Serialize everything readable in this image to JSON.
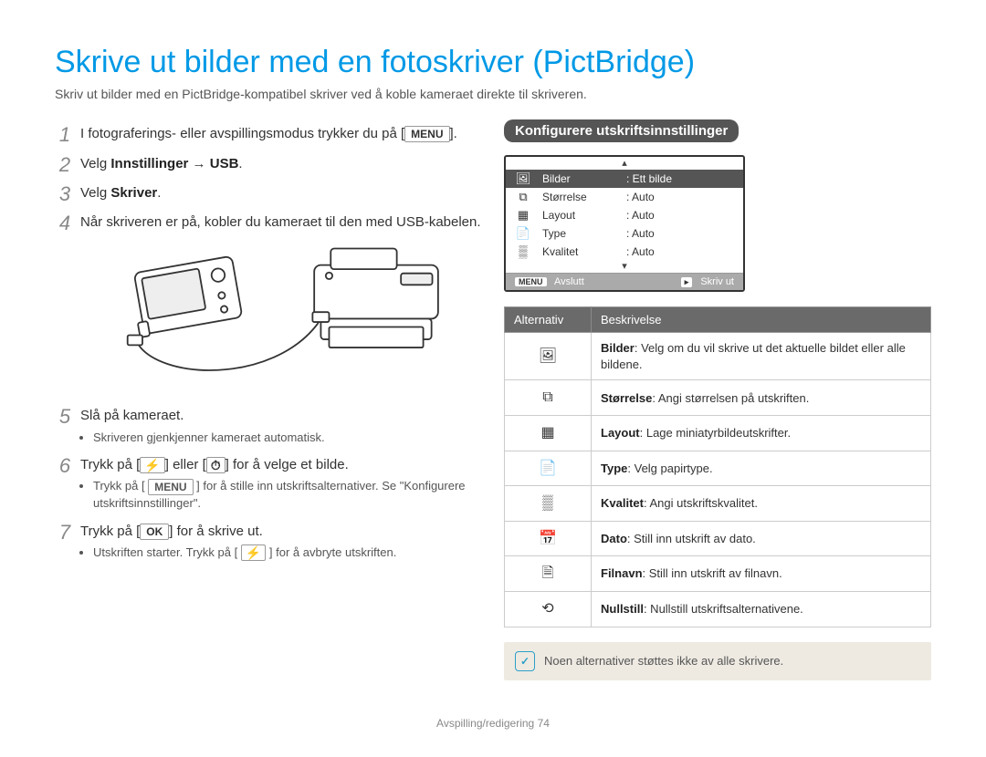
{
  "title": "Skrive ut bilder med en fotoskriver (PictBridge)",
  "intro": "Skriv ut bilder med en PictBridge-kompatibel skriver ved å koble kameraet direkte til skriveren.",
  "buttons": {
    "menu": "MENU",
    "ok": "OK",
    "flash": "⚡",
    "timer": "⏱",
    "play": "▸"
  },
  "steps": [
    {
      "num": "1",
      "parts": [
        "I fotograferings- eller avspillingsmodus trykker du på [",
        "MENU",
        "]."
      ]
    },
    {
      "num": "2",
      "parts": [
        "Velg ",
        "Innstillinger",
        " → ",
        "USB",
        "."
      ]
    },
    {
      "num": "3",
      "parts": [
        "Velg ",
        "Skriver",
        "."
      ]
    },
    {
      "num": "4",
      "parts": [
        "Når skriveren er på, kobler du kameraet til den med USB-kabelen."
      ]
    },
    {
      "num": "5",
      "parts": [
        "Slå på kameraet."
      ],
      "sub": [
        "Skriveren gjenkjenner kameraet automatisk."
      ]
    },
    {
      "num": "6",
      "parts": [
        "Trykk på [",
        "⚡",
        "] eller [",
        "⏱",
        "] for å velge et bilde."
      ],
      "sub": [
        "Trykk på [ MENU ] for å stille inn utskriftsalternativer. Se \"Konfigurere utskriftsinnstillinger\"."
      ]
    },
    {
      "num": "7",
      "parts": [
        "Trykk på [",
        "OK",
        "] for å skrive ut."
      ],
      "sub": [
        "Utskriften starter. Trykk på [ ⚡ ] for å avbryte utskriften."
      ]
    }
  ],
  "right": {
    "section_title": "Konfigurere utskriftsinnstillinger",
    "screen": {
      "rows": [
        {
          "icon": "🖼",
          "label": "Bilder",
          "value": "Ett bilde",
          "selected": true
        },
        {
          "icon": "⧉",
          "label": "Størrelse",
          "value": "Auto"
        },
        {
          "icon": "▦",
          "label": "Layout",
          "value": "Auto"
        },
        {
          "icon": "📄",
          "label": "Type",
          "value": "Auto"
        },
        {
          "icon": "▒",
          "label": "Kvalitet",
          "value": "Auto"
        }
      ],
      "footer_left_icon": "MENU",
      "footer_left": "Avslutt",
      "footer_right_icon": "▸",
      "footer_right": "Skriv ut"
    },
    "table_headers": {
      "option": "Alternativ",
      "desc": "Beskrivelse"
    },
    "options": [
      {
        "icon": "🖼",
        "bold": "Bilder",
        "desc": ": Velg om du vil skrive ut det aktuelle bildet eller alle bildene."
      },
      {
        "icon": "⧉",
        "bold": "Størrelse",
        "desc": ": Angi størrelsen på utskriften."
      },
      {
        "icon": "▦",
        "bold": "Layout",
        "desc": ": Lage miniatyrbildeutskrifter."
      },
      {
        "icon": "📄",
        "bold": "Type",
        "desc": ": Velg papirtype."
      },
      {
        "icon": "▒",
        "bold": "Kvalitet",
        "desc": ": Angi utskriftskvalitet."
      },
      {
        "icon": "📅",
        "bold": "Dato",
        "desc": ": Still inn utskrift av dato."
      },
      {
        "icon": "🗎",
        "bold": "Filnavn",
        "desc": ": Still inn utskrift av filnavn."
      },
      {
        "icon": "⟲",
        "bold": "Nullstill",
        "desc": ": Nullstill utskriftsalternativene."
      }
    ],
    "note": "Noen alternativer støttes ikke av alle skrivere."
  },
  "footer": {
    "section": "Avspilling/redigering",
    "page": "74"
  }
}
